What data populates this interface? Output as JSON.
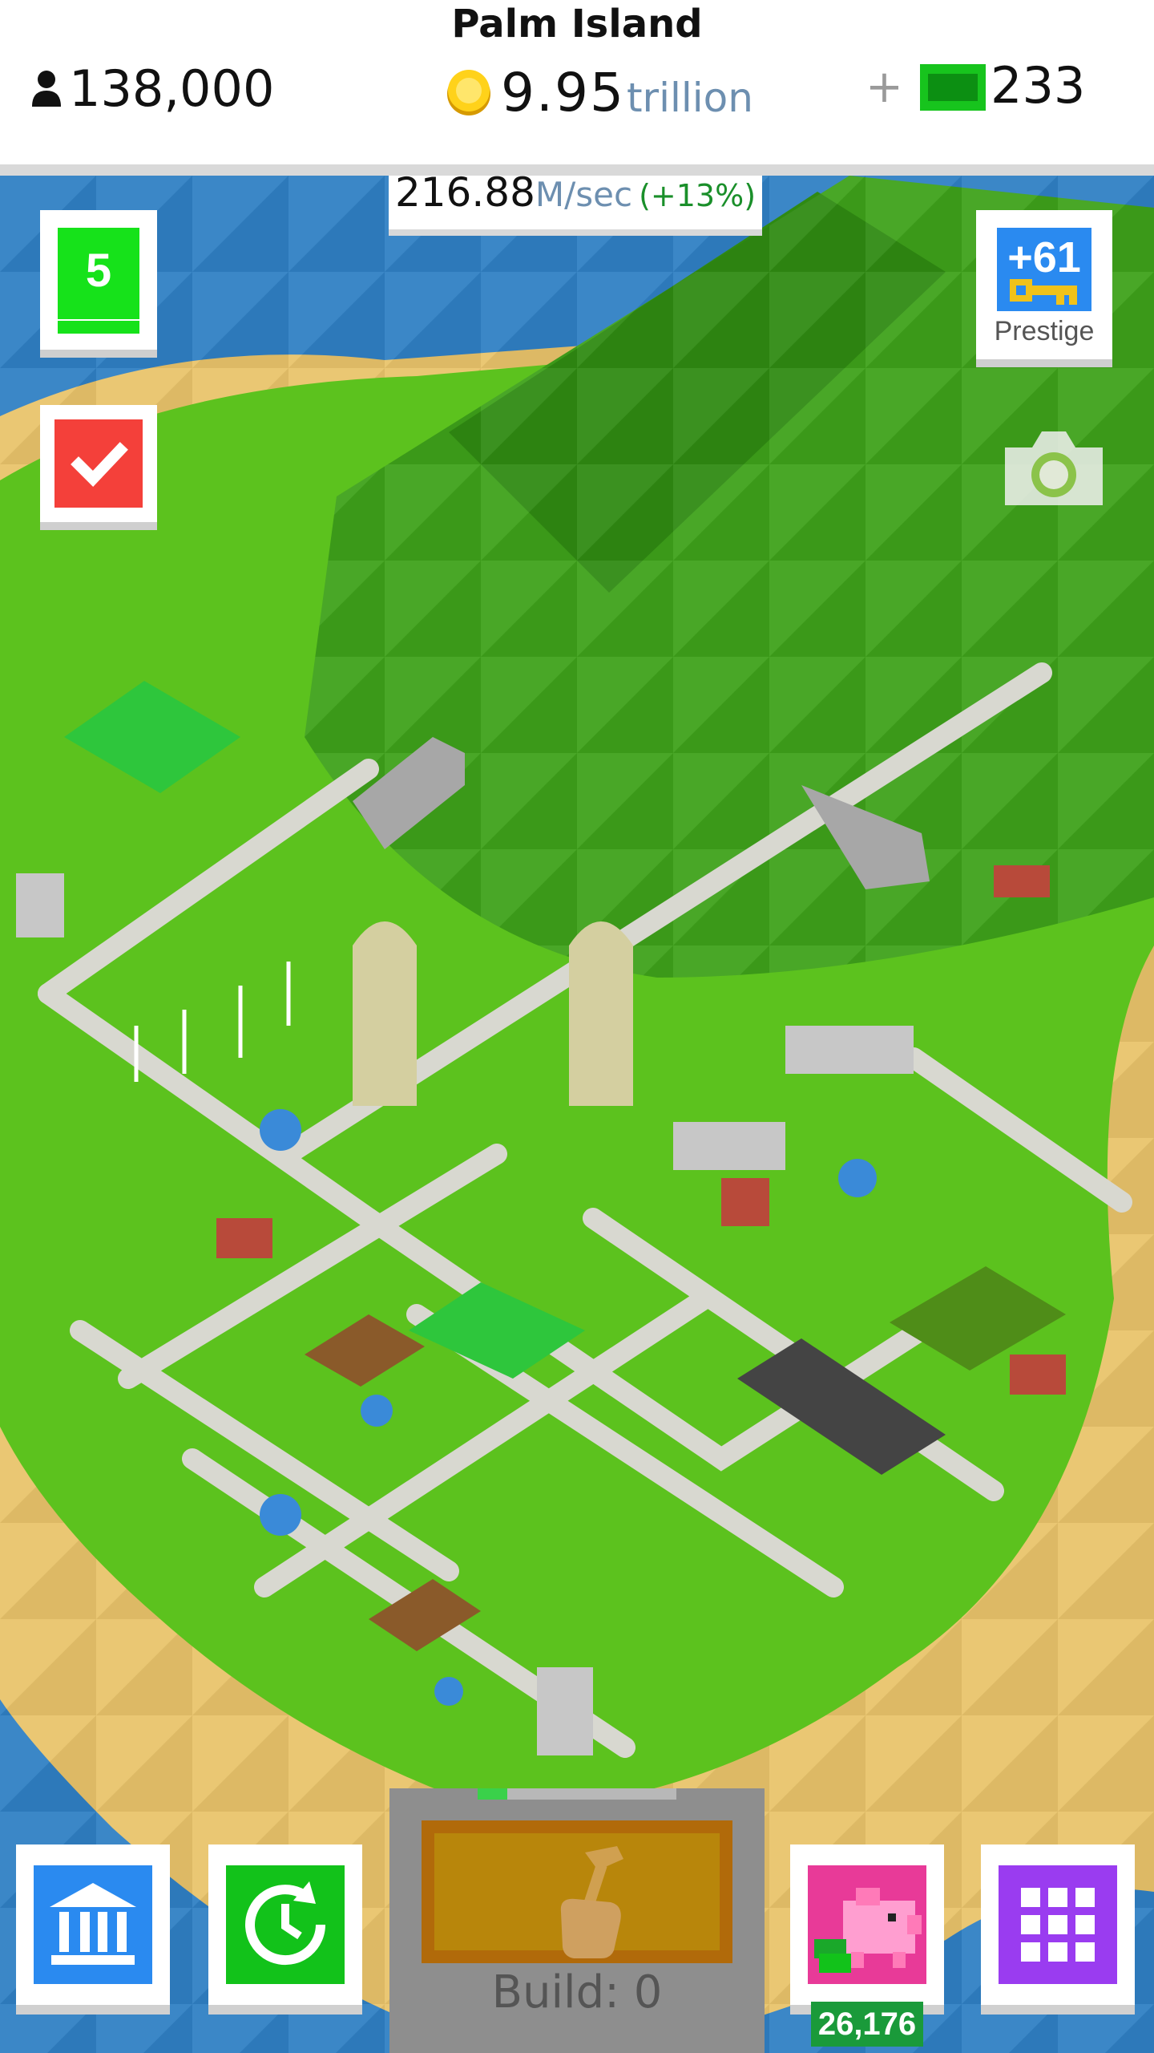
{
  "header": {
    "island_name": "Palm Island",
    "population": "138,000",
    "money_value": "9.95",
    "money_unit": "trillion",
    "plus_label": "+",
    "cash": "233"
  },
  "income": {
    "rate_value": "216.88",
    "rate_unit": "M/sec",
    "rate_bonus": "(+13%)"
  },
  "side_buttons": {
    "level": "5",
    "prestige_bonus": "+61",
    "prestige_label": "Prestige"
  },
  "bottom_bar": {
    "build_label": "Build: 0",
    "build_progress": 0.15,
    "bank_count": "26,176"
  },
  "icons": [
    "person-icon",
    "coin-icon",
    "cash-icon",
    "check-icon",
    "key-icon",
    "camera-icon",
    "museum-icon",
    "clock-boost-icon",
    "piggy-bank-icon",
    "grid-menu-icon",
    "hammer-icon"
  ],
  "colors": {
    "level_green": "#16e21a",
    "task_red": "#f4403a",
    "prestige_blue": "#2a8af0",
    "boost_green": "#12c21a",
    "bank_pink": "#e83a98",
    "menu_purple": "#9a3cf0",
    "build_gold": "#b8860b",
    "ocean": "#2f7fc4",
    "grass": "#5cc21e"
  }
}
